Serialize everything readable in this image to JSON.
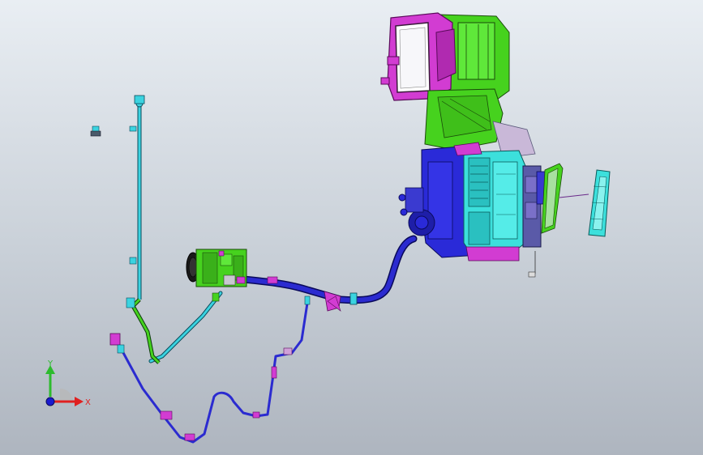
{
  "viewport": {
    "colors": {
      "bg_top": "#e9eef3",
      "bg_bottom": "#aeb5bf",
      "hvac_green": "#46d21e",
      "hvac_blue": "#2a2ad8",
      "hvac_magenta": "#d23cd2",
      "hvac_cyan": "#3ce0dc",
      "line_blue": "#2b2bd0",
      "line_cyan": "#3bd3e0"
    }
  },
  "triad": {
    "y_label": "Y",
    "x_label": "X",
    "y_color": "#2dbb2d",
    "x_color": "#e02020",
    "z_color": "#1a1ad0"
  }
}
